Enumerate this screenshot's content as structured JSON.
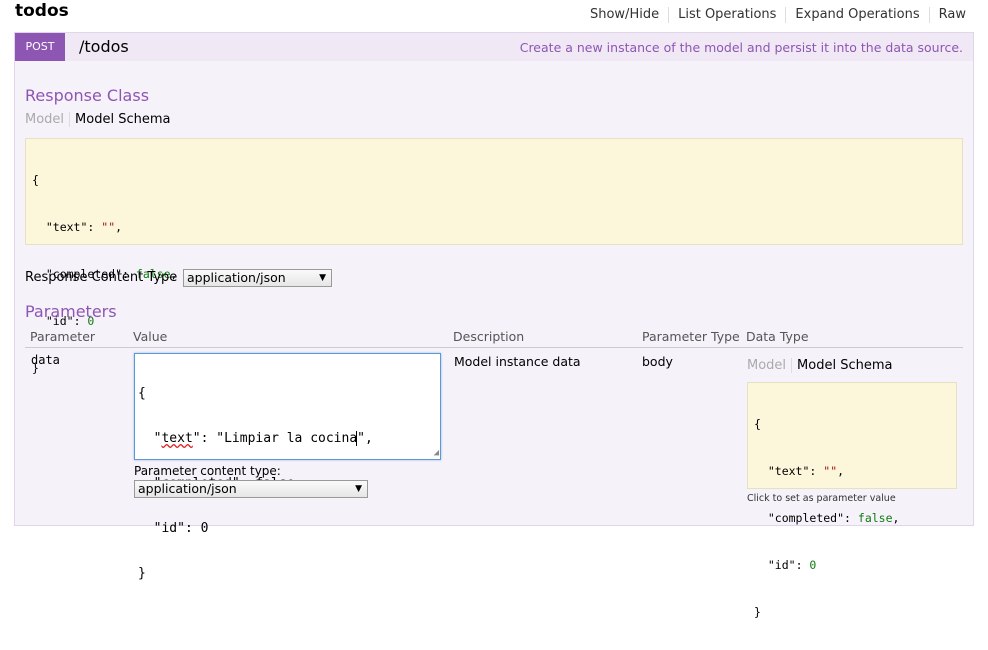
{
  "header": {
    "resource_title": "todos",
    "nav": [
      "Show/Hide",
      "List Operations",
      "Expand Operations",
      "Raw"
    ]
  },
  "operation": {
    "method": "POST",
    "path": "/todos",
    "summary": "Create a new instance of the model and persist it into the data source.",
    "colors": {
      "method_bg": "#8e56b3",
      "panel_bg": "#f6f2f9",
      "schema_bg": "#fcf6db"
    }
  },
  "response_class": {
    "heading": "Response Class",
    "tab_model": "Model",
    "tab_schema": "Model Schema",
    "schema_lines": [
      {
        "open": "{"
      },
      {
        "key": "\"text\"",
        "sep": ": ",
        "val": "\"\"",
        "val_kind": "s",
        "end": ","
      },
      {
        "key": "\"completed\"",
        "sep": ": ",
        "val": "false",
        "val_kind": "b",
        "end": ","
      },
      {
        "key": "\"id\"",
        "sep": ": ",
        "val": "0",
        "val_kind": "n",
        "end": ""
      },
      {
        "open": "}"
      }
    ]
  },
  "response_content_type": {
    "label": "Response Content Type",
    "selected": "application/json"
  },
  "parameters": {
    "heading": "Parameters",
    "columns": [
      "Parameter",
      "Value",
      "Description",
      "Parameter Type",
      "Data Type"
    ],
    "rows": [
      {
        "name": "data",
        "value_lines": [
          "{",
          "  \"text\": \"Limpiar la cocina\",",
          "  \"completed\": false,",
          "  \"id\": 0",
          "}"
        ],
        "content_type_label": "Parameter content type:",
        "content_type_selected": "application/json",
        "description": "Model instance data",
        "param_type": "body",
        "data_type": {
          "tab_model": "Model",
          "tab_schema": "Model Schema",
          "click_hint": "Click to set as parameter value"
        }
      }
    ]
  }
}
